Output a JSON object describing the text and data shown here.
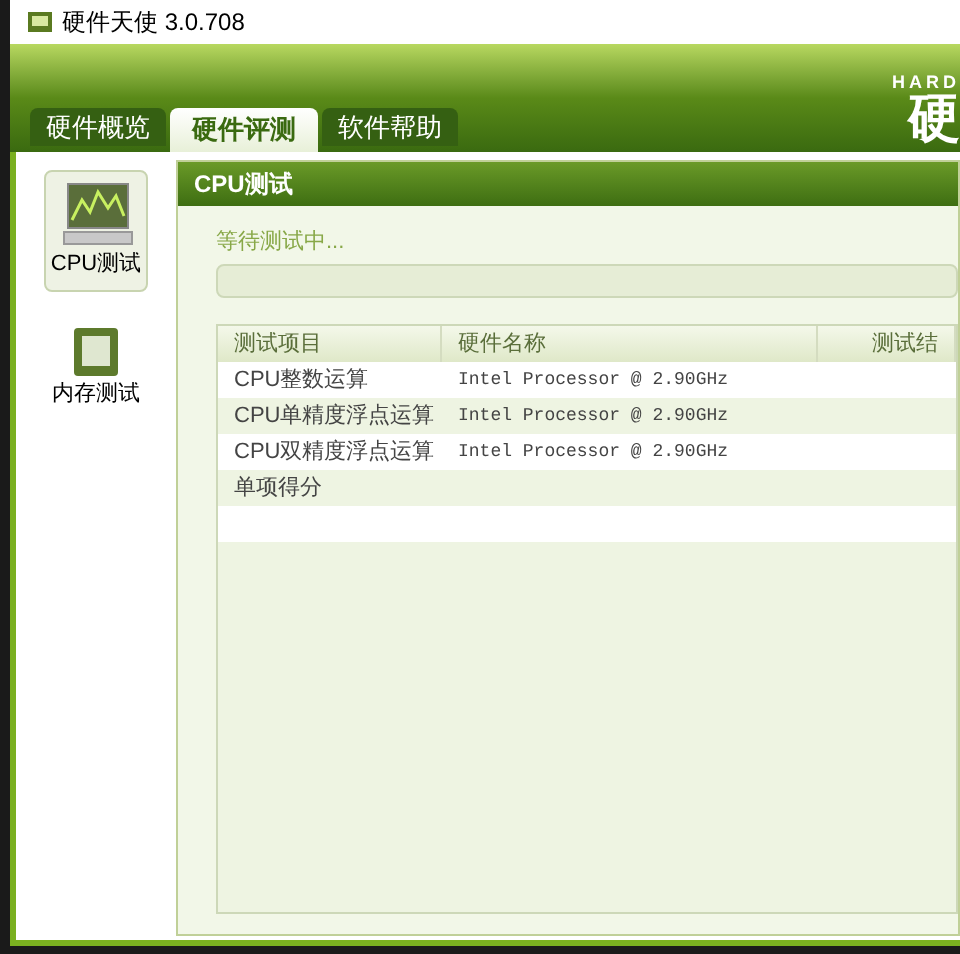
{
  "window": {
    "title": "硬件天使 3.0.708"
  },
  "logo": {
    "tagline": "HARD",
    "mark": "硬"
  },
  "tabs": [
    {
      "label": "硬件概览",
      "selected": false
    },
    {
      "label": "硬件评测",
      "selected": true
    },
    {
      "label": "软件帮助",
      "selected": false
    }
  ],
  "sidebar": {
    "items": [
      {
        "label": "CPU测试",
        "kind": "cpu",
        "selected": true
      },
      {
        "label": "内存测试",
        "kind": "memory",
        "selected": false
      }
    ]
  },
  "panel": {
    "title": "CPU测试",
    "status": "等待测试中...",
    "progress": {
      "level": 0
    }
  },
  "table": {
    "columns": [
      "测试项目",
      "硬件名称",
      "测试结"
    ],
    "rows": [
      [
        "CPU整数运算",
        "Intel Processor @ 2.90GHz",
        ""
      ],
      [
        "CPU单精度浮点运算",
        "Intel Processor @ 2.90GHz",
        ""
      ],
      [
        "CPU双精度浮点运算",
        "Intel Processor @ 2.90GHz",
        ""
      ],
      [
        "单项得分",
        "",
        ""
      ]
    ]
  }
}
